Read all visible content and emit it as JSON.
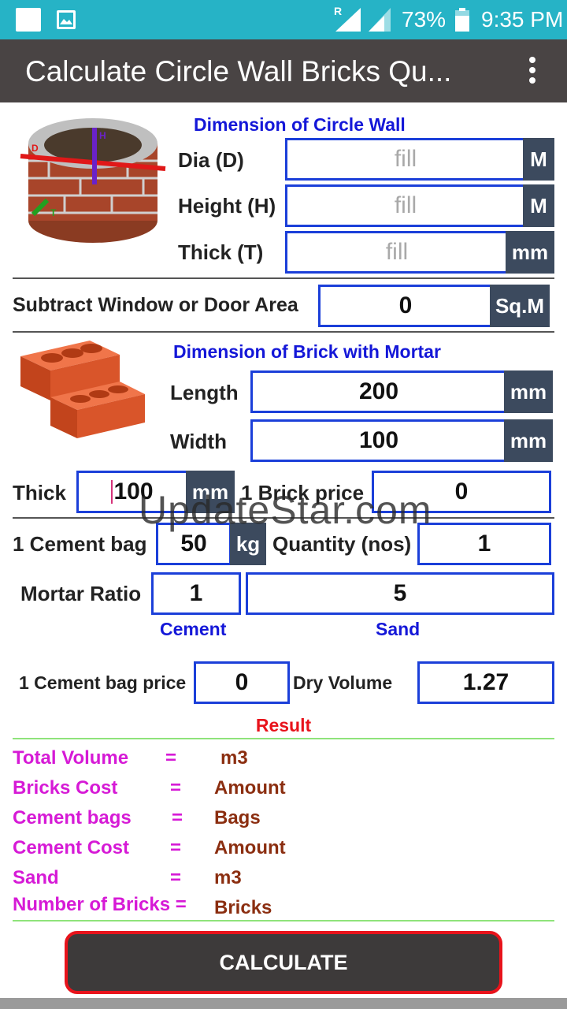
{
  "status_bar": {
    "battery": "73%",
    "time": "9:35 PM",
    "roaming": "R"
  },
  "app_bar": {
    "title": "Calculate Circle Wall Bricks Qu..."
  },
  "circle_wall": {
    "heading": "Dimension of Circle Wall",
    "image_marks": {
      "d": "D",
      "h": "H",
      "t": "T"
    },
    "dia": {
      "label": "Dia (D)",
      "placeholder": "fill",
      "unit": "M"
    },
    "height": {
      "label": "Height (H)",
      "placeholder": "fill",
      "unit": "M"
    },
    "thick": {
      "label": "Thick (T)",
      "placeholder": "fill",
      "unit": "mm"
    }
  },
  "subtract": {
    "label": "Subtract Window or Door Area",
    "value": "0",
    "unit": "Sq.M"
  },
  "brick": {
    "heading": "Dimension of Brick with Mortar",
    "length": {
      "label": "Length",
      "value": "200",
      "unit": "mm"
    },
    "width": {
      "label": "Width",
      "value": "100",
      "unit": "mm"
    },
    "thick": {
      "label": "Thick",
      "value": "100",
      "unit": "mm"
    },
    "price": {
      "label": "1 Brick price",
      "value": "0"
    }
  },
  "cement": {
    "bag": {
      "label": "1 Cement bag",
      "value": "50",
      "unit": "kg"
    },
    "quantity": {
      "label": "Quantity (nos)",
      "value": "1"
    }
  },
  "mortar": {
    "label": "Mortar Ratio",
    "cement_value": "1",
    "sand_value": "5",
    "cement_caption": "Cement",
    "sand_caption": "Sand"
  },
  "cement_price": {
    "label": "1 Cement bag price",
    "value": "0"
  },
  "dry_volume": {
    "label": "Dry Volume",
    "value": "1.27"
  },
  "result": {
    "heading": "Result",
    "rows": [
      {
        "label": "Total  Volume",
        "eq": "=",
        "value": "m3"
      },
      {
        "label": "Bricks Cost",
        "eq": "=",
        "value": "Amount"
      },
      {
        "label": "Cement bags",
        "eq": "=",
        "value": "Bags"
      },
      {
        "label": "Cement Cost",
        "eq": "=",
        "value": "Amount"
      },
      {
        "label": "Sand",
        "eq": "=",
        "value": "m3"
      },
      {
        "label": "Number of Bricks =",
        "eq": "",
        "value": "Bricks"
      }
    ]
  },
  "watermark": "UpdateStar.com",
  "calculate_button": "CALCULATE",
  "colors": {
    "status_bar": "#26b3c6",
    "app_bar": "#494444",
    "field_border": "#1b3fd9",
    "unit_box": "#3c4a5e",
    "heading_blue": "#1417d8",
    "result_red": "#e8131b",
    "result_label": "#d61ad6",
    "result_value": "#8b2e10",
    "button_border": "#e8131b"
  }
}
